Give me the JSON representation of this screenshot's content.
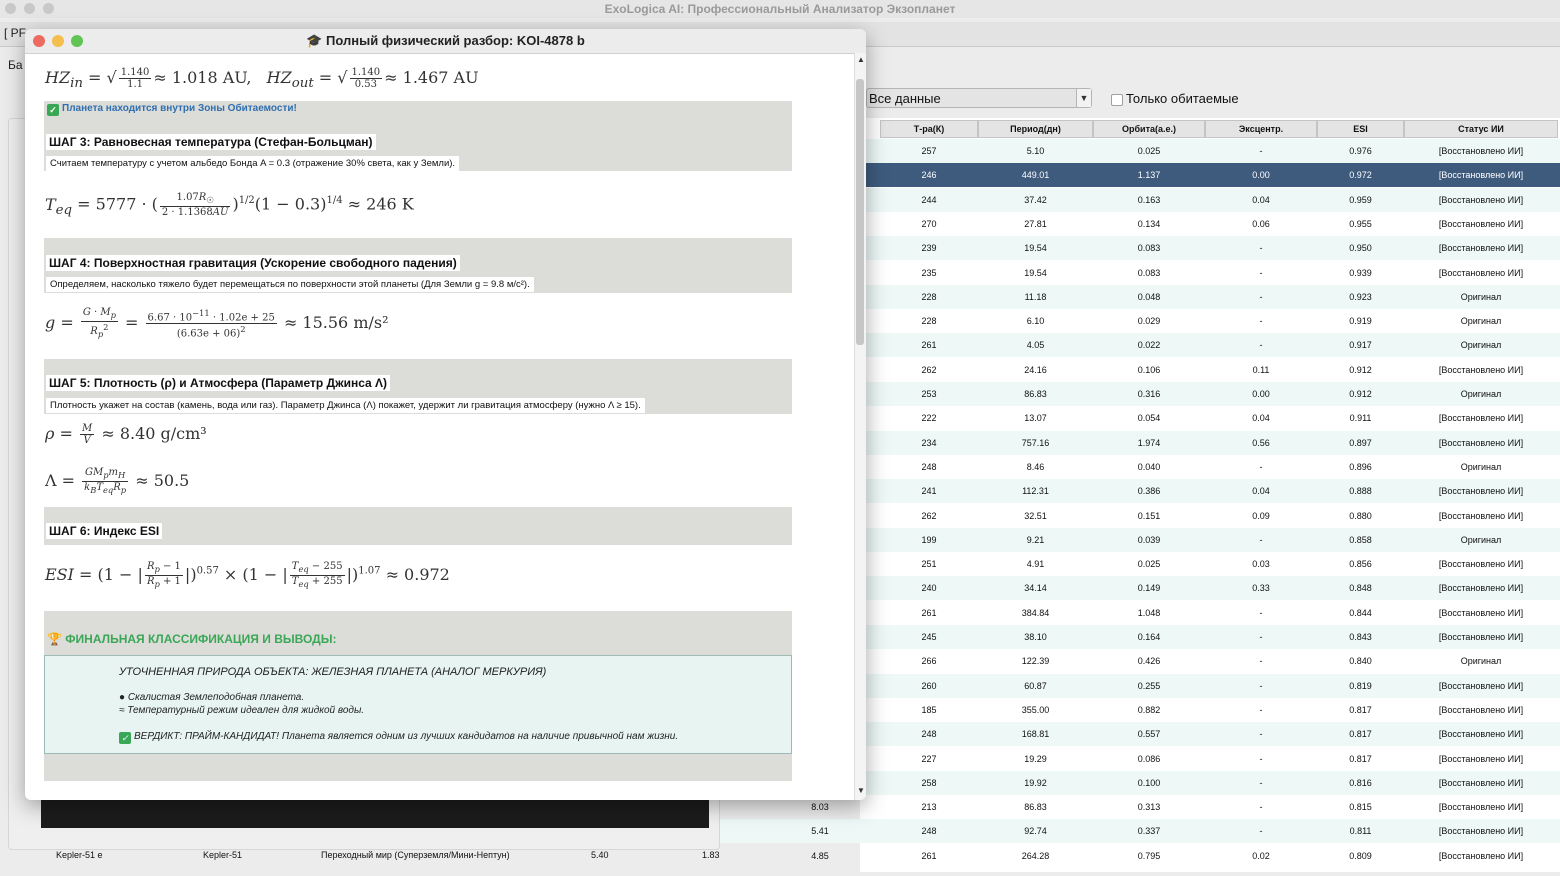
{
  "app": {
    "title": "ExoLogica AI: Профессиональный Анализатор Экзопланет",
    "tab_short": "[ PF",
    "tab_short2": "Ба",
    "filter_value": "Все данные",
    "only_habitable_label": "Только обитаемые"
  },
  "table": {
    "headers": [
      "Т-ра(К)",
      "Период(дн)",
      "Орбита(а.е.)",
      "Эксцентр.",
      "ESI",
      "Статус ИИ"
    ],
    "rows": [
      {
        "c0": "",
        "t": "257",
        "p": "5.10",
        "o": "0.025",
        "e": "-",
        "esi": "0.976",
        "s": "[Восстановлено ИИ]"
      },
      {
        "c0": "",
        "t": "246",
        "p": "449.01",
        "o": "1.137",
        "e": "0.00",
        "esi": "0.972",
        "s": "[Восстановлено ИИ]"
      },
      {
        "c0": "",
        "t": "244",
        "p": "37.42",
        "o": "0.163",
        "e": "0.04",
        "esi": "0.959",
        "s": "[Восстановлено ИИ]"
      },
      {
        "c0": "",
        "t": "270",
        "p": "27.81",
        "o": "0.134",
        "e": "0.06",
        "esi": "0.955",
        "s": "[Восстановлено ИИ]"
      },
      {
        "c0": "",
        "t": "239",
        "p": "19.54",
        "o": "0.083",
        "e": "-",
        "esi": "0.950",
        "s": "[Восстановлено ИИ]"
      },
      {
        "c0": "",
        "t": "235",
        "p": "19.54",
        "o": "0.083",
        "e": "-",
        "esi": "0.939",
        "s": "[Восстановлено ИИ]"
      },
      {
        "c0": "",
        "t": "228",
        "p": "11.18",
        "o": "0.048",
        "e": "-",
        "esi": "0.923",
        "s": "Оригинал"
      },
      {
        "c0": "",
        "t": "228",
        "p": "6.10",
        "o": "0.029",
        "e": "-",
        "esi": "0.919",
        "s": "Оригинал"
      },
      {
        "c0": "",
        "t": "261",
        "p": "4.05",
        "o": "0.022",
        "e": "-",
        "esi": "0.917",
        "s": "Оригинал"
      },
      {
        "c0": "",
        "t": "262",
        "p": "24.16",
        "o": "0.106",
        "e": "0.11",
        "esi": "0.912",
        "s": "[Восстановлено ИИ]"
      },
      {
        "c0": "",
        "t": "253",
        "p": "86.83",
        "o": "0.316",
        "e": "0.00",
        "esi": "0.912",
        "s": "Оригинал"
      },
      {
        "c0": "",
        "t": "222",
        "p": "13.07",
        "o": "0.054",
        "e": "0.04",
        "esi": "0.911",
        "s": "[Восстановлено ИИ]"
      },
      {
        "c0": "",
        "t": "234",
        "p": "757.16",
        "o": "1.974",
        "e": "0.56",
        "esi": "0.897",
        "s": "[Восстановлено ИИ]"
      },
      {
        "c0": "",
        "t": "248",
        "p": "8.46",
        "o": "0.040",
        "e": "-",
        "esi": "0.896",
        "s": "Оригинал"
      },
      {
        "c0": "",
        "t": "241",
        "p": "112.31",
        "o": "0.386",
        "e": "0.04",
        "esi": "0.888",
        "s": "[Восстановлено ИИ]"
      },
      {
        "c0": "",
        "t": "262",
        "p": "32.51",
        "o": "0.151",
        "e": "0.09",
        "esi": "0.880",
        "s": "[Восстановлено ИИ]"
      },
      {
        "c0": "",
        "t": "199",
        "p": "9.21",
        "o": "0.039",
        "e": "-",
        "esi": "0.858",
        "s": "Оригинал"
      },
      {
        "c0": "",
        "t": "251",
        "p": "4.91",
        "o": "0.025",
        "e": "0.03",
        "esi": "0.856",
        "s": "[Восстановлено ИИ]"
      },
      {
        "c0": "",
        "t": "240",
        "p": "34.14",
        "o": "0.149",
        "e": "0.33",
        "esi": "0.848",
        "s": "[Восстановлено ИИ]"
      },
      {
        "c0": "",
        "t": "261",
        "p": "384.84",
        "o": "1.048",
        "e": "-",
        "esi": "0.844",
        "s": "[Восстановлено ИИ]"
      },
      {
        "c0": "",
        "t": "245",
        "p": "38.10",
        "o": "0.164",
        "e": "-",
        "esi": "0.843",
        "s": "[Восстановлено ИИ]"
      },
      {
        "c0": "",
        "t": "266",
        "p": "122.39",
        "o": "0.426",
        "e": "-",
        "esi": "0.840",
        "s": "Оригинал"
      },
      {
        "c0": "",
        "t": "260",
        "p": "60.87",
        "o": "0.255",
        "e": "-",
        "esi": "0.819",
        "s": "[Восстановлено ИИ]"
      },
      {
        "c0": "",
        "t": "185",
        "p": "355.00",
        "o": "0.882",
        "e": "-",
        "esi": "0.817",
        "s": "[Восстановлено ИИ]"
      },
      {
        "c0": "",
        "t": "248",
        "p": "168.81",
        "o": "0.557",
        "e": "-",
        "esi": "0.817",
        "s": "[Восстановлено ИИ]"
      },
      {
        "c0": "",
        "t": "227",
        "p": "19.29",
        "o": "0.086",
        "e": "-",
        "esi": "0.817",
        "s": "[Восстановлено ИИ]"
      },
      {
        "c0": "",
        "t": "258",
        "p": "19.92",
        "o": "0.100",
        "e": "-",
        "esi": "0.816",
        "s": "[Восстановлено ИИ]"
      },
      {
        "c0": "8.03",
        "t": "213",
        "p": "86.83",
        "o": "0.313",
        "e": "-",
        "esi": "0.815",
        "s": "[Восстановлено ИИ]"
      },
      {
        "c0": "5.41",
        "t": "248",
        "p": "92.74",
        "o": "0.337",
        "e": "-",
        "esi": "0.811",
        "s": "[Восстановлено ИИ]"
      },
      {
        "c0": "4.85",
        "t": "261",
        "p": "264.28",
        "o": "0.795",
        "e": "0.02",
        "esi": "0.809",
        "s": "[Восстановлено ИИ]"
      }
    ],
    "selected_row": 1,
    "bottom_left": {
      "name": "Kepler-51 e",
      "host": "Kepler-51",
      "type": "Переходный мир (Суперземля/Мини-Нептун)",
      "v1": "5.40",
      "v2": "1.83"
    }
  },
  "popup": {
    "title": "Полный физический разбор: KOI-4878 b",
    "hz_line": "HZ_in ≈ 1.018 AU, HZ_out ≈ 1.467 AU",
    "hz_in_value": "≈ 1.018 AU,",
    "hz_out_value": "≈ 1.467 AU",
    "hz_note": "Планета находится внутри Зоны Обитаемости!",
    "step3_title": "ШАГ 3: Равновесная температура (Стефан-Больцман)",
    "step3_desc": "Считаем температуру с учетом альбедо Бонда A = 0.3 (отражение 30% света, как у Земли).",
    "step3_result": "≈ 246 K",
    "step4_title": "ШАГ 4: Поверхностная гравитация (Ускорение свободного падения)",
    "step4_desc": "Определяем, насколько тяжело будет перемещаться по поверхности этой планеты (Для Земли g = 9.8 м/с²).",
    "step4_result": "≈ 15.56 m/s²",
    "step5_title": "ШАГ 5: Плотность (ρ) и Атмосфера (Параметр Джинса Λ)",
    "step5_desc": "Плотность укажет на состав (камень, вода или газ). Параметр Джинса (Λ) покажет, удержит ли гравитация атмосферу (нужно Λ ≥ 15).",
    "density_result": "≈ 8.40 g/cm³",
    "jeans_result": "≈ 50.5",
    "step6_title": "ШАГ 6: Индекс ESI",
    "esi_result": "≈ 0.972",
    "final_title": "ФИНАЛЬНАЯ КЛАССИФИКАЦИЯ И ВЫВОДЫ:",
    "final_nature": "УТОЧНЕННАЯ ПРИРОДА ОБЪЕКТА: ЖЕЛЕЗНАЯ ПЛАНЕТА (АНАЛОГ МЕРКУРИЯ)",
    "final_rocky": "Скалистая Землеподобная планета.",
    "final_temp": "Температурный режим идеален для жидкой воды.",
    "final_verdict": "ВЕРДИКТ: ПРАЙМ-КАНДИДАТ! Планета является одним из лучших кандидатов на наличие привычной нам жизни."
  },
  "colors": {
    "selection": "#3e5b7e",
    "alt_row": "#edf8f7",
    "accent_green": "#3aa757",
    "link_blue": "#2f6fb0"
  }
}
